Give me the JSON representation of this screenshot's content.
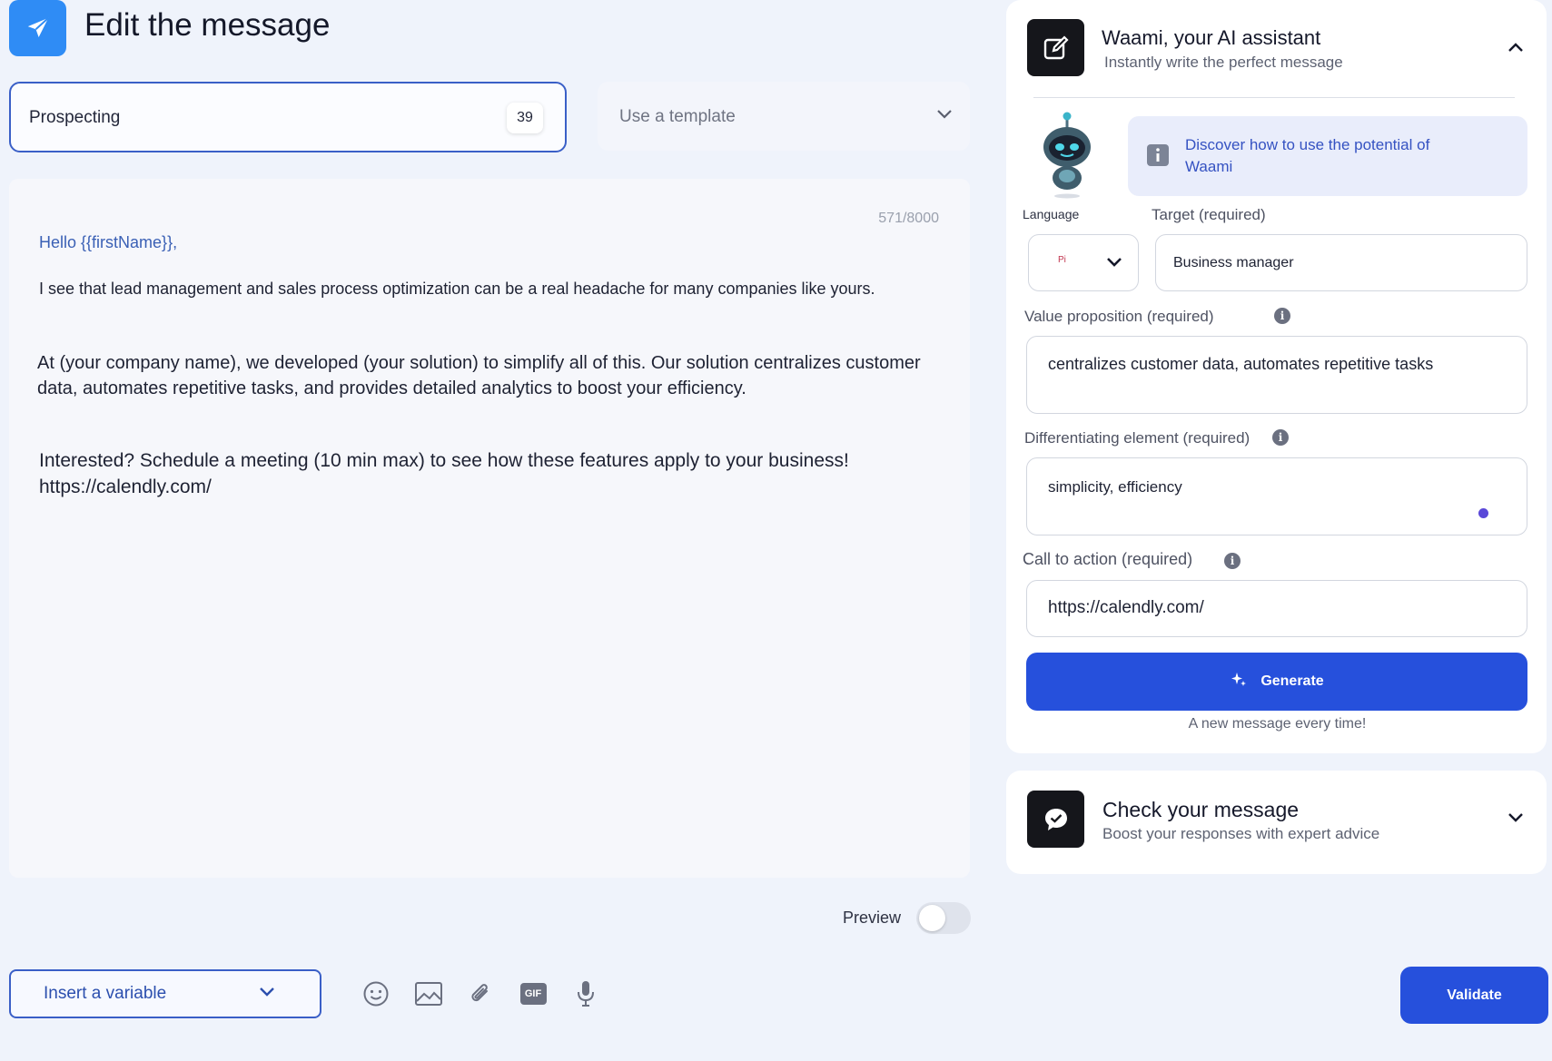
{
  "header": {
    "title": "Edit the message",
    "icon": "paper-plane-icon",
    "accent": "#2f8cf5"
  },
  "message_name": {
    "value": "Prospecting",
    "remaining": "39"
  },
  "template_select": {
    "placeholder": "Use a template"
  },
  "editor": {
    "counter": "571/8000",
    "greeting": "Hello {{firstName}},",
    "paragraph1": "I see that lead management and sales process optimization can be a real headache for many companies like yours.",
    "paragraph2": "At (your company name), we developed (your solution) to simplify all of this. Our solution centralizes customer data, automates repetitive tasks, and provides detailed analytics to boost your efficiency.",
    "paragraph3_line1": "Interested? Schedule a meeting (10 min max) to see how these features apply to your business!",
    "paragraph3_line2": "https://calendly.com/"
  },
  "preview": {
    "label": "Preview",
    "enabled": false
  },
  "footer": {
    "insert_variable": "Insert a variable",
    "tools": [
      "emoji-icon",
      "image-icon",
      "attachment-icon",
      "gif-icon",
      "microphone-icon"
    ],
    "gif_label": "GIF",
    "validate": "Validate"
  },
  "ai_assistant": {
    "title": "Waami, your AI assistant",
    "subtitle": "Instantly write the perfect message",
    "info": "Discover how to use the potential of Waami",
    "language_label": "Language",
    "language_value": "Pi",
    "target_label": "Target (required)",
    "target_value": "Business manager",
    "value_prop_label": "Value proposition (required)",
    "value_prop_value": "centralizes customer data, automates repetitive tasks",
    "diff_label": "Differentiating element (required)",
    "diff_value": "simplicity, efficiency",
    "cta_label": "Call to action (required)",
    "cta_value": "https://calendly.com/",
    "generate": "Generate",
    "generate_note": "A new message every time!"
  },
  "check_message": {
    "title": "Check your message",
    "subtitle": "Boost your responses with expert advice"
  },
  "colors": {
    "primary": "#2650dc",
    "background": "#eff3fb"
  }
}
